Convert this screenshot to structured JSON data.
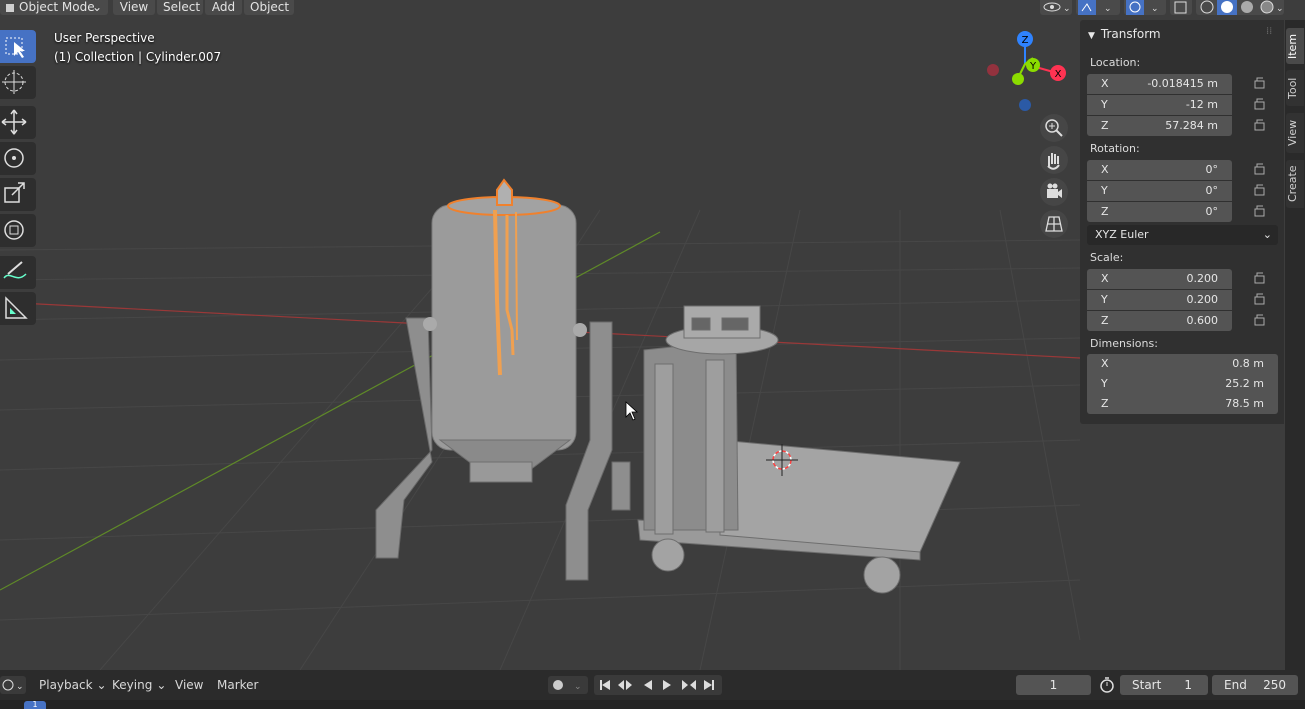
{
  "header": {
    "mode": "Object Mode",
    "menus": [
      "View",
      "Select",
      "Add",
      "Object"
    ]
  },
  "viewport": {
    "view_name": "User Perspective",
    "collection_object": "(1) Collection | Cylinder.007"
  },
  "gizmo": {
    "z": "Z",
    "y": "Y",
    "x": "X"
  },
  "panel": {
    "title": "Transform",
    "location_label": "Location:",
    "location": [
      {
        "axis": "X",
        "value": "-0.018415 m"
      },
      {
        "axis": "Y",
        "value": "-12 m"
      },
      {
        "axis": "Z",
        "value": "57.284 m"
      }
    ],
    "rotation_label": "Rotation:",
    "rotation": [
      {
        "axis": "X",
        "value": "0°"
      },
      {
        "axis": "Y",
        "value": "0°"
      },
      {
        "axis": "Z",
        "value": "0°"
      }
    ],
    "rotation_mode": "XYZ Euler",
    "scale_label": "Scale:",
    "scale": [
      {
        "axis": "X",
        "value": "0.200"
      },
      {
        "axis": "Y",
        "value": "0.200"
      },
      {
        "axis": "Z",
        "value": "0.600"
      }
    ],
    "dimensions_label": "Dimensions:",
    "dimensions": [
      {
        "axis": "X",
        "value": "0.8 m"
      },
      {
        "axis": "Y",
        "value": "25.2 m"
      },
      {
        "axis": "Z",
        "value": "78.5 m"
      }
    ]
  },
  "side_tabs": [
    "Item",
    "Tool",
    "View",
    "Create"
  ],
  "timeline": {
    "playback": "Playback",
    "keying": "Keying",
    "view": "View",
    "marker": "Marker",
    "current_frame": "1",
    "start_label": "Start",
    "start": "1",
    "end_label": "End",
    "end": "250",
    "ruler_first": "1"
  },
  "colors": {
    "accent": "#4672c4",
    "selection": "#f0812d",
    "x_axis": "#ff3352",
    "y_axis": "#8bdc00",
    "z_axis": "#2f83ff"
  }
}
